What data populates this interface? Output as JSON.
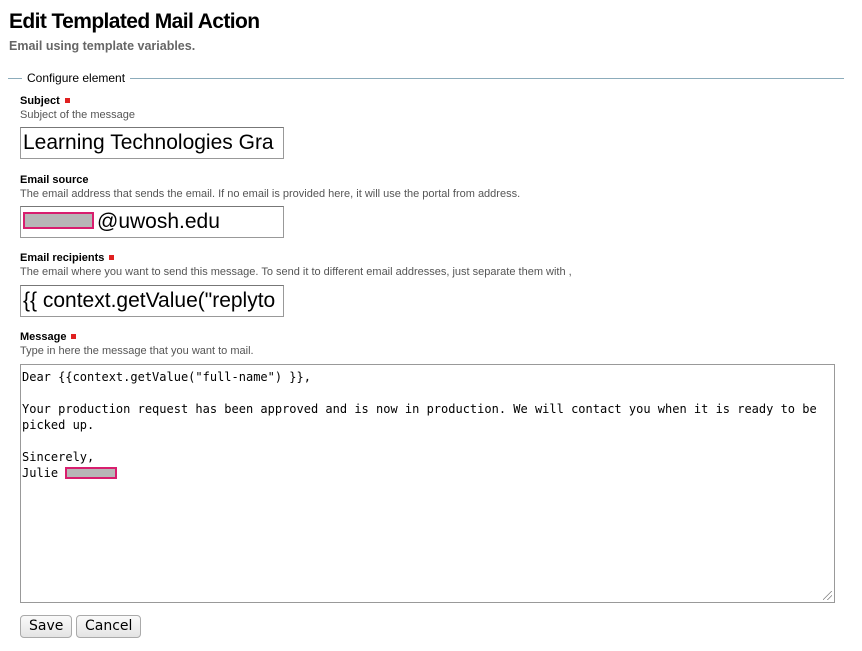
{
  "header": {
    "title": "Edit Templated Mail Action",
    "description": "Email using template variables."
  },
  "fieldset": {
    "legend": "Configure element"
  },
  "fields": {
    "subject": {
      "label": "Subject",
      "help": "Subject of the message",
      "value": "Learning Technologies Gra"
    },
    "source": {
      "label": "Email source",
      "help": "The email address that sends the email. If no email is provided here, it will use the portal from address.",
      "value_domain": "@uwosh.edu"
    },
    "recipients": {
      "label": "Email recipients",
      "help": "The email where you want to send this message. To send it to different email addresses, just separate them with ,",
      "value": "{{ context.getValue(\"replyto"
    },
    "message": {
      "label": "Message",
      "help": "Type in here the message that you want to mail.",
      "line1": "Dear {{context.getValue(\"full-name\") }},",
      "line2": "Your production request has been approved and is now in production. We will contact you when it is ready to be",
      "line3": "picked up.",
      "line4": "Sincerely,",
      "line5": "Julie "
    }
  },
  "actions": {
    "save_label": "Save",
    "cancel_label": "Cancel"
  },
  "colors": {
    "required_marker": "#e02020",
    "redaction_border": "#d81e6e",
    "fieldset_line": "#8cacbb"
  }
}
